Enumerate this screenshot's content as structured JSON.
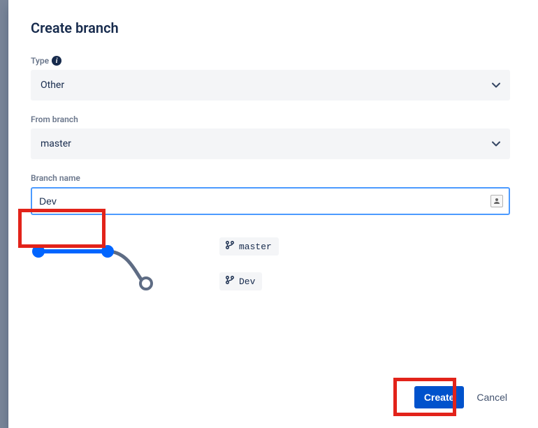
{
  "dialog": {
    "title": "Create branch",
    "type": {
      "label": "Type",
      "value": "Other"
    },
    "fromBranch": {
      "label": "From branch",
      "value": "master"
    },
    "branchName": {
      "label": "Branch name",
      "value": "Dev"
    },
    "diagram": {
      "sourceTag": "master",
      "targetTag": "Dev"
    },
    "actions": {
      "primary": "Create",
      "cancel": "Cancel"
    }
  }
}
